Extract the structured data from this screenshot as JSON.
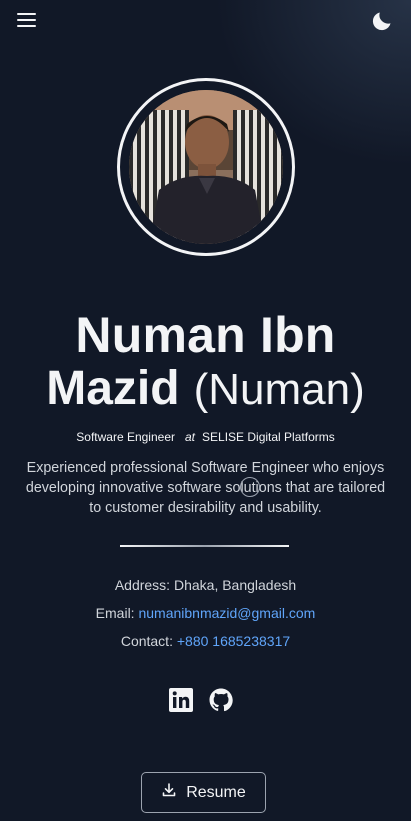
{
  "nav": {
    "menu_icon": "hamburger-menu-icon",
    "theme_icon": "moon-icon"
  },
  "profile": {
    "avatar_alt": "Profile photo",
    "name_first": "Numan Ibn",
    "name_last": "Mazid",
    "nickname": "(Numan)",
    "role": "Software Engineer",
    "at": "at",
    "company": "SELISE Digital Platforms",
    "bio": "Experienced professional Software Engineer who enjoys developing innovative software solutions that are tailored to customer desirability and usability."
  },
  "contact": {
    "address_label": "Address:",
    "address": "Dhaka, Bangladesh",
    "email_label": "Email:",
    "email": "numanibnmazid@gmail.com",
    "phone_label": "Contact:",
    "phone": "+880 1685238317"
  },
  "social": {
    "linkedin_icon": "linkedin-icon",
    "github_icon": "github-icon"
  },
  "resume": {
    "label": "Resume",
    "icon": "download-icon"
  },
  "colors": {
    "background": "#111827",
    "link": "#60a5fa",
    "text": "#f3f4f6"
  }
}
